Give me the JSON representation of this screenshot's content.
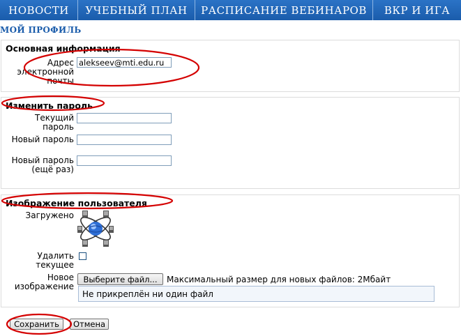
{
  "nav": {
    "items": [
      "НОВОСТИ",
      "УЧЕБНЫЙ ПЛАН",
      "РАСПИСАНИЕ ВЕБИНАРОВ",
      "ВКР И ИГА"
    ]
  },
  "page_title": "МОЙ ПРОФИЛЬ",
  "basic_info": {
    "legend": "Основная информация",
    "email_label": "Адрес электронной почты",
    "email_value": "alekseev@mti.edu.ru"
  },
  "change_password": {
    "legend": "Изменить пароль",
    "current_label": "Текущий пароль",
    "new_label": "Новый пароль",
    "repeat_label": "Новый пароль (ещё раз)"
  },
  "user_image": {
    "legend": "Изображение пользователя",
    "uploaded_label": "Загружено",
    "delete_label": "Удалить текущее",
    "new_image_label": "Новое изображение",
    "choose_file_button": "Выберите файл...",
    "max_size_text": "Максимальный размер для новых файлов: 2Мбайт",
    "no_file_text": "Не прикреплён ни один файл"
  },
  "actions": {
    "save_label": "Сохранить",
    "cancel_label": "Отмена"
  },
  "colors": {
    "nav_bg": "#1a5cab",
    "title": "#1a5cab",
    "annotation": "#d40000"
  }
}
